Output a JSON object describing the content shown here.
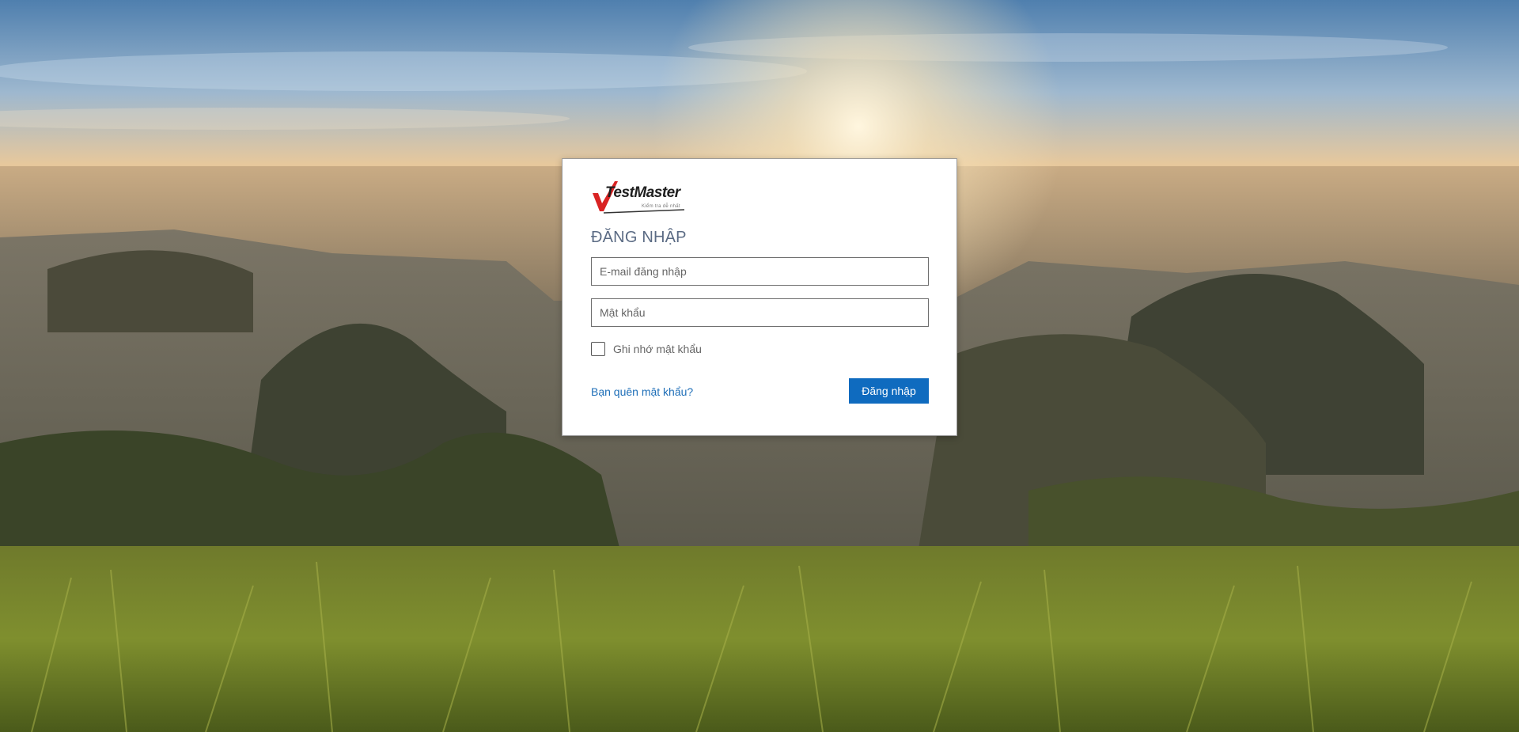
{
  "brand": {
    "name": "TestMaster",
    "tagline": "Kiểm tra dễ nhất"
  },
  "login": {
    "title": "ĐĂNG NHẬP",
    "email_placeholder": "E-mail đăng nhập",
    "password_placeholder": "Mật khẩu",
    "remember_label": "Ghi nhớ mật khẩu",
    "remember_checked": false,
    "forgot_label": "Bạn quên mật khẩu?",
    "submit_label": "Đăng nhập"
  },
  "colors": {
    "accent": "#0f6bbf",
    "link": "#1f6fb8",
    "title": "#5b6b84",
    "logo_red": "#d92323"
  },
  "icons": {
    "logo_mark": "checkmark-icon"
  }
}
